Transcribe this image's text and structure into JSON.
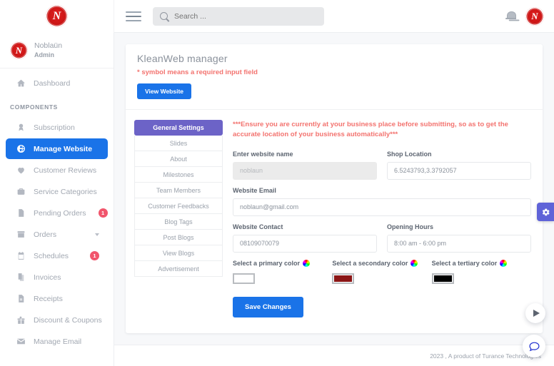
{
  "topbar": {
    "logo_glyph": "N",
    "menu_icon": "hamburger-icon",
    "search": {
      "placeholder": "Search ...",
      "value": ""
    },
    "bell_icon": "bell-icon",
    "avatar_icon": "user-avatar"
  },
  "sidebar": {
    "profile": {
      "name": "Noblaün",
      "role": "Admin"
    },
    "section_label": "COMPONENTS",
    "dashboard": {
      "label": "Dashboard",
      "icon": "home-icon"
    },
    "items": [
      {
        "label": "Subscription",
        "icon": "medal-icon",
        "badge": "",
        "active": false,
        "caret": false
      },
      {
        "label": "Manage Website",
        "icon": "globe-icon",
        "badge": "",
        "active": true,
        "caret": false
      },
      {
        "label": "Customer Reviews",
        "icon": "heart-icon",
        "badge": "",
        "active": false,
        "caret": false
      },
      {
        "label": "Service Categories",
        "icon": "briefcase-icon",
        "badge": "",
        "active": false,
        "caret": false
      },
      {
        "label": "Pending Orders",
        "icon": "file-icon",
        "badge": "1",
        "active": false,
        "caret": false
      },
      {
        "label": "Orders",
        "icon": "box-icon",
        "badge": "",
        "active": false,
        "caret": true
      },
      {
        "label": "Schedules",
        "icon": "calendar-icon",
        "badge": "1",
        "active": false,
        "caret": false
      },
      {
        "label": "Invoices",
        "icon": "copy-icon",
        "badge": "",
        "active": false,
        "caret": false
      },
      {
        "label": "Receipts",
        "icon": "receipt-icon",
        "badge": "",
        "active": false,
        "caret": false
      },
      {
        "label": "Discount & Coupons",
        "icon": "gift-icon",
        "badge": "",
        "active": false,
        "caret": false
      },
      {
        "label": "Manage Email",
        "icon": "envelope-icon",
        "badge": "",
        "active": false,
        "caret": false
      }
    ]
  },
  "main": {
    "title": "KleanWeb manager",
    "required_note": "* symbol means a required input field",
    "view_website_label": "View Website",
    "warning": "***Ensure you are currently at your business place before submitting, so as to get the accurate location of your business automatically***",
    "tabs": [
      {
        "label": "General Settings",
        "active": true
      },
      {
        "label": "Slides",
        "active": false
      },
      {
        "label": "About",
        "active": false
      },
      {
        "label": "Milestones",
        "active": false
      },
      {
        "label": "Team Members",
        "active": false
      },
      {
        "label": "Customer Feedbacks",
        "active": false
      },
      {
        "label": "Blog Tags",
        "active": false
      },
      {
        "label": "Post Blogs",
        "active": false
      },
      {
        "label": "View Blogs",
        "active": false
      },
      {
        "label": "Advertisement",
        "active": false
      }
    ],
    "fields": {
      "website_name": {
        "label": "Enter website name",
        "value": "noblaun",
        "disabled": true
      },
      "shop_location": {
        "label": "Shop Location",
        "value": "6.5243793,3.3792057",
        "disabled": false
      },
      "website_email": {
        "label": "Website Email",
        "value": "noblaun@gmail.com",
        "disabled": false
      },
      "website_contact": {
        "label": "Website Contact",
        "value": "08109070079",
        "disabled": false
      },
      "opening_hours": {
        "label": "Opening Hours",
        "value": "8:00 am - 6:00 pm",
        "disabled": false
      }
    },
    "colors": [
      {
        "label": "Select a primary color",
        "value": "#ffffff"
      },
      {
        "label": "Select a secondary color",
        "value": "#8b1616"
      },
      {
        "label": "Select a tertiary color",
        "value": "#000000"
      }
    ],
    "save_label": "Save Changes"
  },
  "footer": {
    "text": "2023 , A product of Turance Technologies"
  },
  "floating": {
    "settings_icon": "gear-icon",
    "play_icon": "play-icon",
    "chat_icon": "chat-bubble-icon"
  },
  "theme": {
    "primary_blue": "#1a73e8",
    "tab_purple": "#6c63c7",
    "badge_red": "#f1556c",
    "warn_red": "#f3736f",
    "logo_red": "#c81414"
  }
}
